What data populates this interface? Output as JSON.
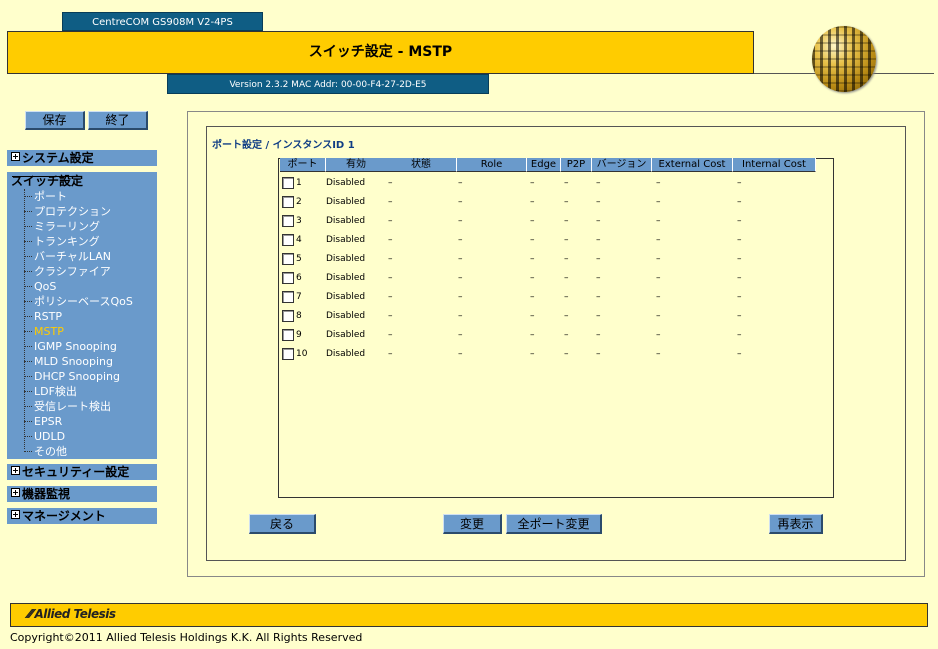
{
  "header": {
    "model": "CentreCOM GS908M V2-4PS",
    "title": "スイッチ設定 - MSTP",
    "version": "Version 2.3.2 MAC Addr: 00-00-F4-27-2D-E5"
  },
  "toolbar": {
    "save_label": "保存",
    "exit_label": "終了"
  },
  "sidebar": {
    "system": "システム設定",
    "switch": "スイッチ設定",
    "items": [
      "ポート",
      "プロテクション",
      "ミラーリング",
      "トランキング",
      "バーチャルLAN",
      "クラシファイア",
      "QoS",
      "ポリシーベースQoS",
      "RSTP",
      "MSTP",
      "IGMP Snooping",
      "MLD Snooping",
      "DHCP Snooping",
      "LDF検出",
      "受信レート検出",
      "EPSR",
      "UDLD",
      "その他"
    ],
    "active_item": "MSTP",
    "security": "セキュリティー設定",
    "monitor": "機器監視",
    "management": "マネージメント"
  },
  "main": {
    "section_title": "ポート設定 / インスタンスID 1",
    "columns": [
      "ポート",
      "有効",
      "状態",
      "Role",
      "Edge",
      "P2P",
      "バージョン",
      "External Cost",
      "Internal Cost"
    ],
    "rows": [
      {
        "port": "1",
        "enabled": "Disabled",
        "state": "–",
        "role": "–",
        "edge": "–",
        "p2p": "–",
        "version": "–",
        "ext": "–",
        "int": "–"
      },
      {
        "port": "2",
        "enabled": "Disabled",
        "state": "–",
        "role": "–",
        "edge": "–",
        "p2p": "–",
        "version": "–",
        "ext": "–",
        "int": "–"
      },
      {
        "port": "3",
        "enabled": "Disabled",
        "state": "–",
        "role": "–",
        "edge": "–",
        "p2p": "–",
        "version": "–",
        "ext": "–",
        "int": "–"
      },
      {
        "port": "4",
        "enabled": "Disabled",
        "state": "–",
        "role": "–",
        "edge": "–",
        "p2p": "–",
        "version": "–",
        "ext": "–",
        "int": "–"
      },
      {
        "port": "5",
        "enabled": "Disabled",
        "state": "–",
        "role": "–",
        "edge": "–",
        "p2p": "–",
        "version": "–",
        "ext": "–",
        "int": "–"
      },
      {
        "port": "6",
        "enabled": "Disabled",
        "state": "–",
        "role": "–",
        "edge": "–",
        "p2p": "–",
        "version": "–",
        "ext": "–",
        "int": "–"
      },
      {
        "port": "7",
        "enabled": "Disabled",
        "state": "–",
        "role": "–",
        "edge": "–",
        "p2p": "–",
        "version": "–",
        "ext": "–",
        "int": "–"
      },
      {
        "port": "8",
        "enabled": "Disabled",
        "state": "–",
        "role": "–",
        "edge": "–",
        "p2p": "–",
        "version": "–",
        "ext": "–",
        "int": "–"
      },
      {
        "port": "9",
        "enabled": "Disabled",
        "state": "–",
        "role": "–",
        "edge": "–",
        "p2p": "–",
        "version": "–",
        "ext": "–",
        "int": "–"
      },
      {
        "port": "10",
        "enabled": "Disabled",
        "state": "–",
        "role": "–",
        "edge": "–",
        "p2p": "–",
        "version": "–",
        "ext": "–",
        "int": "–"
      }
    ],
    "buttons": {
      "back": "戻る",
      "change": "変更",
      "change_all": "全ポート変更",
      "refresh": "再表示"
    }
  },
  "footer": {
    "logo": "Allied Telesis",
    "copyright": "Copyright©2011 Allied Telesis Holdings K.K. All Rights Reserved"
  },
  "colors": {
    "accent": "#FFCC00",
    "sidebar": "#6A9ACB",
    "header_blue": "#0F5D84",
    "background": "#FFFFCC"
  }
}
